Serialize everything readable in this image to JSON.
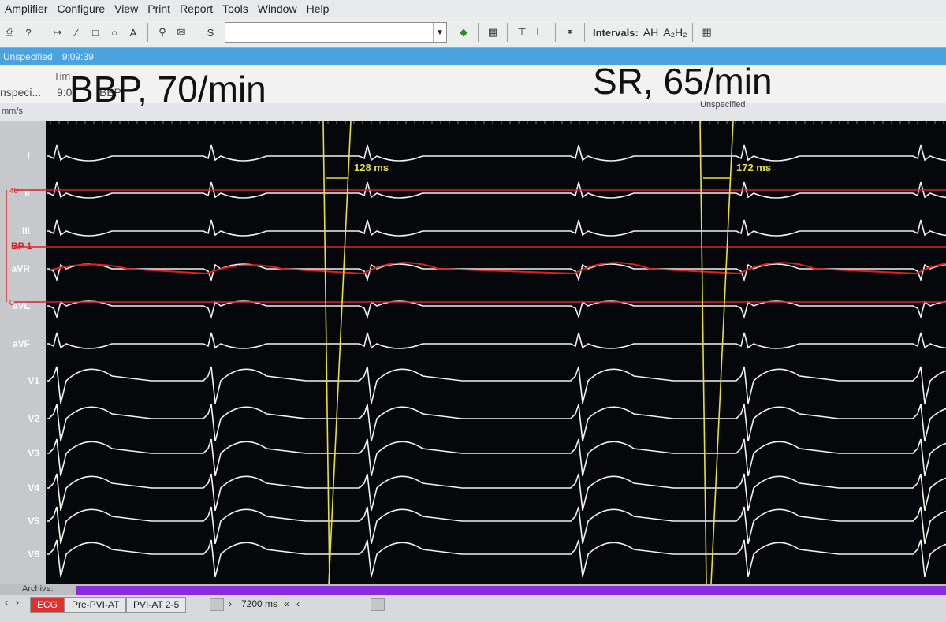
{
  "menu": [
    "Amplifier",
    "Configure",
    "View",
    "Print",
    "Report",
    "Tools",
    "Window",
    "Help"
  ],
  "toolbar": {
    "combo_value": "",
    "intervals_label": "Intervals:",
    "interval_ah": "AH",
    "interval_a2h2": "A₂H₂",
    "text_tool": "A",
    "stim_tool": "S"
  },
  "status": {
    "label": "Unspecified",
    "time": "9:09:39"
  },
  "events": {
    "header": "Tim",
    "row_name": "nspeci...",
    "row_time": "9:0",
    "row_comment": "BBP"
  },
  "overlay": {
    "left": "BBP, 70/min",
    "right": "SR, 65/min"
  },
  "unit_label": "mm/s",
  "marker_label": "Unspecified",
  "leads": [
    "I",
    "II",
    "III",
    "aVR",
    "aVL",
    "aVF",
    "V1",
    "V2",
    "V3",
    "V4",
    "V5",
    "V6"
  ],
  "bp": {
    "channel": "BP 1",
    "top": "40",
    "bottom": "0"
  },
  "calipers": [
    {
      "label": "128 ms"
    },
    {
      "label": "172 ms"
    }
  ],
  "archive_label": "Archive:",
  "tabs": [
    {
      "label": "ECG",
      "active": true
    },
    {
      "label": "Pre-PVI-AT",
      "active": false
    },
    {
      "label": "PVI-AT 2-5",
      "active": false
    }
  ],
  "scroll_readout": "7200 ms",
  "colors": {
    "trace": "#f2f2f2",
    "bp": "#e02020",
    "caliper": "#e8e03a",
    "screen": "#05070a"
  }
}
